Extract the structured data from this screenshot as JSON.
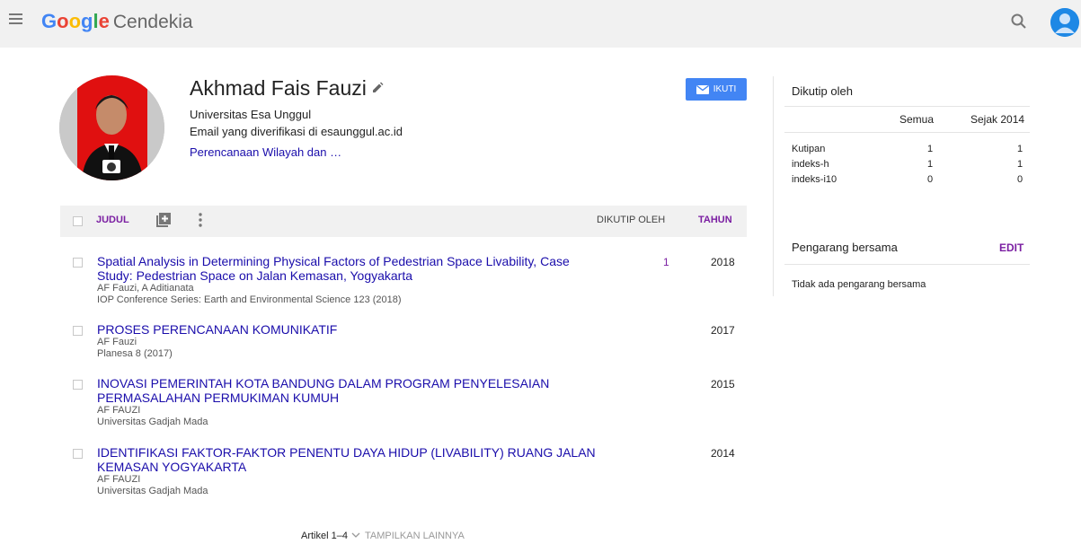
{
  "app": {
    "brand_google": [
      "G",
      "o",
      "o",
      "g",
      "l",
      "e"
    ],
    "brand_product": "Cendekia"
  },
  "profile": {
    "name": "Akhmad Fais Fauzi",
    "affiliation": "Universitas Esa Unggul",
    "email": "Email yang diverifikasi di esaunggul.ac.id",
    "interest": "Perencanaan Wilayah dan …",
    "follow_label": "IKUTI"
  },
  "table": {
    "col_title": "JUDUL",
    "col_cited": "DIKUTIP OLEH",
    "col_year": "TAHUN",
    "rows": [
      {
        "title": "Spatial Analysis in Determining Physical Factors of Pedestrian Space Livability, Case Study: Pedestrian Space on Jalan Kemasan, Yogyakarta",
        "authors": "AF Fauzi, A Aditianata",
        "venue": "IOP Conference Series: Earth and Environmental Science 123 (2018)",
        "cited": "1",
        "year": "2018"
      },
      {
        "title": "PROSES PERENCANAAN KOMUNIKATIF",
        "authors": "AF Fauzi",
        "venue": "Planesa 8 (2017)",
        "cited": "",
        "year": "2017"
      },
      {
        "title": "INOVASI PEMERINTAH KOTA BANDUNG DALAM PROGRAM PENYELESAIAN PERMASALAHAN PERMUKIMAN KUMUH",
        "authors": "AF FAUZI",
        "venue": "Universitas Gadjah Mada",
        "cited": "",
        "year": "2015"
      },
      {
        "title": "IDENTIFIKASI FAKTOR-FAKTOR PENENTU DAYA HIDUP (LIVABILITY) RUANG JALAN KEMASAN YOGYAKARTA",
        "authors": "AF FAUZI",
        "venue": "Universitas Gadjah Mada",
        "cited": "",
        "year": "2014"
      }
    ],
    "articles_count": "Artikel 1–4",
    "show_more": "TAMPILKAN LAINNYA"
  },
  "cited_by": {
    "title": "Dikutip oleh",
    "col_all": "Semua",
    "col_since": "Sejak 2014",
    "stats": [
      {
        "label": "Kutipan",
        "all": "1",
        "since": "1"
      },
      {
        "label": "indeks-h",
        "all": "1",
        "since": "1"
      },
      {
        "label": "indeks-i10",
        "all": "0",
        "since": "0"
      }
    ]
  },
  "coauthors": {
    "title": "Pengarang bersama",
    "edit_label": "EDIT",
    "empty_text": "Tidak ada pengarang bersama"
  },
  "colors": {
    "link": "#1a0dab",
    "accent_purple": "#7b1fa2",
    "follow_blue": "#4285f4"
  }
}
